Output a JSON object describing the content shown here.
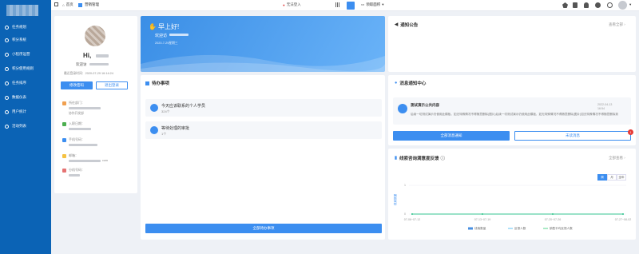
{
  "sidebar": {
    "items": [
      {
        "label": "任务规划",
        "icon": "task-icon"
      },
      {
        "label": "积分系统",
        "icon": "coin-icon"
      },
      {
        "label": "小程序运营",
        "icon": "miniapp-icon"
      },
      {
        "label": "积分使用规则",
        "icon": "rule-icon"
      },
      {
        "label": "任务排序",
        "icon": "sort-icon"
      },
      {
        "label": "数据仪表",
        "icon": "dashboard-icon"
      },
      {
        "label": "用户统计",
        "icon": "users-icon"
      },
      {
        "label": "活动列表",
        "icon": "list-icon"
      }
    ]
  },
  "topbar": {
    "home": "首页",
    "module": "营销管理",
    "status": "无法登入",
    "store": "领取面积"
  },
  "profile": {
    "greeting": "Hi,",
    "welcome": "欢迎访",
    "last_login": "最近登录时间：2020-07-29 16:14:24",
    "change_pwd": "修改密码",
    "logout": "退出登录",
    "fields": [
      {
        "label": "所在部门："
      },
      {
        "label": "入职日期："
      },
      {
        "label": "手机号码："
      },
      {
        "label": "邮箱："
      },
      {
        "label": "分机号码："
      }
    ],
    "dept_suffix": "协作开发部",
    "email_suffix": "com"
  },
  "banner": {
    "title": "早上好!",
    "welcome": "欢迎访",
    "date": "2020-7-29星期三"
  },
  "todo": {
    "title": "待办事项",
    "items": [
      {
        "title": "今天应该联系的个人学员",
        "count": "324个"
      },
      {
        "title": "等待处理的审批",
        "count": "1个"
      }
    ],
    "all_button": "全部待办事项"
  },
  "notice": {
    "title": "通知公告",
    "more": "查看全部"
  },
  "messages": {
    "title": "消息通知中心",
    "item_title": "测试演示公共内容",
    "item_body": "后续一切测试演示仍使用此模板，如无特殊情况不得随意删除(图片)后续一切测试演示仍使用此模板，如无特殊情况不得随意删除(图片)如无特殊情况不得随意删除到…",
    "item_date": "2022-04-13",
    "item_time": "16:54",
    "all_button": "全部消息通知",
    "unread_button": "未读消息",
    "unread_count": "1"
  },
  "feedback": {
    "title": "线索咨询满意度反馈",
    "more": "全部查看",
    "tabs": [
      "周",
      "月",
      "全年"
    ],
    "legend": [
      "线索数量",
      "反馈人数",
      "销售平均反馈人数"
    ]
  },
  "chart_data": {
    "type": "line",
    "x": [
      "07-06~07-12",
      "07-13~07-19",
      "07-20~07-26",
      "07-27~08-02"
    ],
    "series": [
      {
        "name": "线索数量",
        "values": [
          0,
          0,
          0,
          0
        ]
      },
      {
        "name": "反馈人数",
        "values": [
          0,
          0,
          0,
          0
        ]
      },
      {
        "name": "销售平均反馈人数",
        "values": [
          0,
          0,
          0,
          0
        ]
      }
    ],
    "y_ticks": [
      "0",
      "1"
    ],
    "ylabel": "线索数量",
    "ylim": [
      0,
      1
    ],
    "colors": [
      "#4a90e2",
      "#3bb4f2",
      "#2ecc71"
    ]
  }
}
